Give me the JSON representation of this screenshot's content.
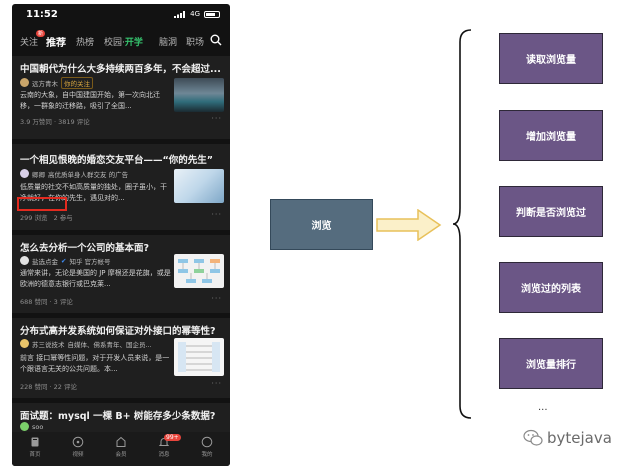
{
  "phone": {
    "status_time": "11:52",
    "network": "4G",
    "tabs": [
      "关注",
      "推荐",
      "热榜",
      "校园·",
      "开学",
      "脑洞",
      "职场"
    ],
    "follow_badge": "新",
    "feed": [
      {
        "title": "中国朝代为什么大多持续两百多年，不会超过...",
        "author": "远方青木",
        "author_tag": "你的关注",
        "snippet": "云南的大象，自中国建国开始，第一次向北迁移，一群象的迁移路，吸引了全国...",
        "meta": "3.9 万赞同 · 3819 评论"
      },
      {
        "title": "一个相见恨晚的婚恋交友平台——“你的先生”",
        "author": "卿卿",
        "author_desc": "高优质单身人群交友 的广告",
        "snippet": "低质量的社交不如高质量的独处，圈子虽小，干净就好，在你的先生，遇见对的...",
        "views": "299 浏览",
        "participants": "2 参与"
      },
      {
        "title": "怎么去分析一个公司的基本面?",
        "author": "盐选点金",
        "author_source": "知乎 官方帐号",
        "snippet": "通常来讲，无论是美国的 JP 摩根还是花旗，或是欧洲的德意志银行或巴克莱...",
        "meta": "688 赞同 · 3 评论"
      },
      {
        "title": "分布式高并发系统如何保证对外接口的幂等性?",
        "author": "苏三说技术",
        "author_desc": "自媒体、佛系青年、国企员...",
        "snippet": "前言 接口幂等性问题，对于开发人员来说，是一个跟语言无关的公共问题。本...",
        "meta": "228 赞同 · 22 评论"
      },
      {
        "title": "面试题：mysql 一棵 B+ 树能存多少条数据?",
        "author": "soo"
      }
    ],
    "more_glyph": "···",
    "bottom_nav": [
      "首页",
      "视频",
      "会员",
      "消息",
      "我的"
    ],
    "message_badge": "99+"
  },
  "diagram": {
    "source_label": "浏览",
    "actions": [
      "读取浏览量",
      "增加浏览量",
      "判断是否浏览过",
      "浏览过的列表",
      "浏览量排行"
    ],
    "ellipsis": "...",
    "watermark": "bytejava",
    "colors": {
      "source_box": "#556c7e",
      "action_box": "#6b5686",
      "arrow_fill": "#fbf0c9",
      "arrow_stroke": "#e8c15a",
      "highlight": "#e22a1f"
    }
  }
}
